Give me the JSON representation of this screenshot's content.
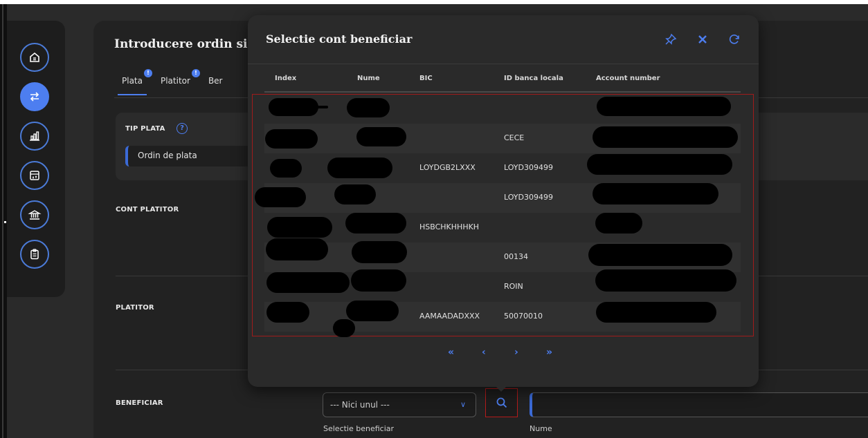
{
  "page": {
    "title": "Introducere ordin si",
    "tabs": [
      {
        "label": "Plata",
        "badge": "!"
      },
      {
        "label": "Platitor",
        "badge": "!"
      },
      {
        "label": "Ber",
        "badge": ""
      }
    ],
    "tip_plata": {
      "label": "TIP PLATA",
      "help": "?",
      "value": "Ordin de plata"
    },
    "sections": {
      "cont_platitor": "CONT PLATITOR",
      "platitor": "PLATITOR",
      "beneficiar": "BENEFICIAR"
    },
    "beneficiar": {
      "select_value": "--- Nici unul ---",
      "select_caption": "Selectie beneficiar",
      "name_caption": "Nume"
    }
  },
  "sidebar": {
    "items": [
      {
        "icon": "home-icon"
      },
      {
        "icon": "transfer-icon",
        "active": true
      },
      {
        "icon": "chart-icon"
      },
      {
        "icon": "calendar-icon"
      },
      {
        "icon": "bank-icon"
      },
      {
        "icon": "clipboard-icon"
      }
    ]
  },
  "modal": {
    "title": "Selectie cont beneficiar",
    "icons": [
      "pin-icon",
      "close-icon",
      "refresh-icon"
    ],
    "columns": [
      "Index",
      "Nume",
      "BIC",
      "ID banca locala",
      "Account number"
    ],
    "rows": [
      {
        "bic": "",
        "local_id": ""
      },
      {
        "bic": "",
        "local_id": "CECE"
      },
      {
        "bic": "LOYDGB2LXXX",
        "local_id": "LOYD309499"
      },
      {
        "bic": "",
        "local_id": "LOYD309499"
      },
      {
        "bic": "HSBCHKHHHKH",
        "local_id": ""
      },
      {
        "bic": "",
        "local_id": "00134"
      },
      {
        "bic": "",
        "local_id": "ROIN"
      },
      {
        "bic": "AAMAADADXXX",
        "local_id": "50070010"
      }
    ],
    "pager": {
      "first": "«",
      "prev": "‹",
      "next": "›",
      "last": "»"
    }
  }
}
